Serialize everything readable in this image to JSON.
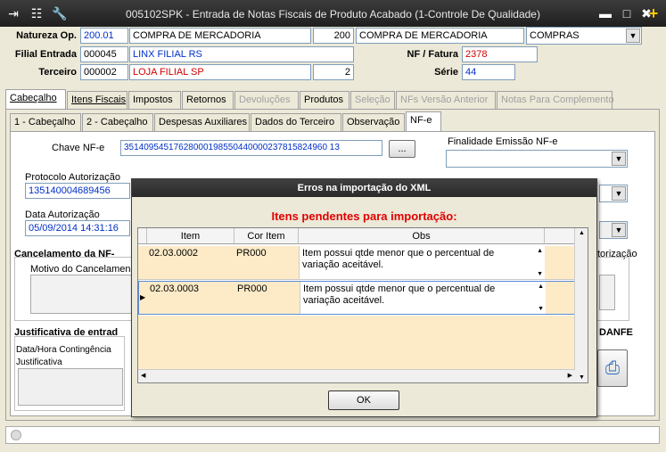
{
  "window": {
    "title": "005102SPK - Entrada de Notas Fiscais de Produto Acabado (1-Controle De Qualidade)"
  },
  "header": {
    "natureza_label": "Natureza Op.",
    "natureza_code": "200.01",
    "natureza_desc": "COMPRA DE MERCADORIA",
    "natureza_code2": "200",
    "natureza_desc2": "COMPRA DE MERCADORIA",
    "natureza_type": "COMPRAS",
    "filial_label": "Filial Entrada",
    "filial_code": "000045",
    "filial_name": "LINX FILIAL RS",
    "nf_label": "NF / Fatura",
    "nf_value": "2378",
    "terceiro_label": "Terceiro",
    "terceiro_code": "000002",
    "terceiro_name": "LOJA FILIAL SP",
    "terceiro_num": "2",
    "serie_label": "Série",
    "serie_value": "44"
  },
  "main_tabs": [
    "Cabeçalho",
    "Itens Fiscais",
    "Impostos",
    "Retornos",
    "Devoluções",
    "Produtos",
    "Seleção",
    "NFs Versão Anterior",
    "Notas Para Complemento"
  ],
  "sub_tabs": [
    "1 - Cabeçalho",
    "2 - Cabeçalho",
    "Despesas Auxiliares",
    "Dados do Terceiro",
    "Observação",
    "NF-e"
  ],
  "nfe": {
    "chave_label": "Chave NF-e",
    "chave_value": "35140954517628000198550440000237815824960 13",
    "chave_btn": "...",
    "finalidade_label": "Finalidade Emissão NF-e",
    "protocolo_label": "Protocolo Autorização",
    "protocolo_value": "135140004689456",
    "data_label": "Data Autorização",
    "data_value": "05/09/2014 14:31:16",
    "cancel_label": "Cancelamento da NF-",
    "motivo_label": "Motivo do Cancelamen",
    "autorizacao_frag": "torização",
    "justificativa_entrada_label": "Justificativa de entrad",
    "danfe_label": "DANFE",
    "contingencia_label": "Data/Hora Contingência",
    "justificativa_label": "Justificativa"
  },
  "dialog": {
    "title": "Erros na importação do XML",
    "heading": "Itens pendentes para importação:",
    "columns": [
      "Item",
      "Cor Item",
      "Obs"
    ],
    "rows": [
      {
        "item": "02.03.0002",
        "cor": "PR000",
        "obs": "Item possui qtde menor que o percentual de variação aceitável."
      },
      {
        "item": "02.03.0003",
        "cor": "PR000",
        "obs": "Item possui qtde menor que o percentual de variação aceitável."
      }
    ],
    "ok_label": "OK"
  }
}
